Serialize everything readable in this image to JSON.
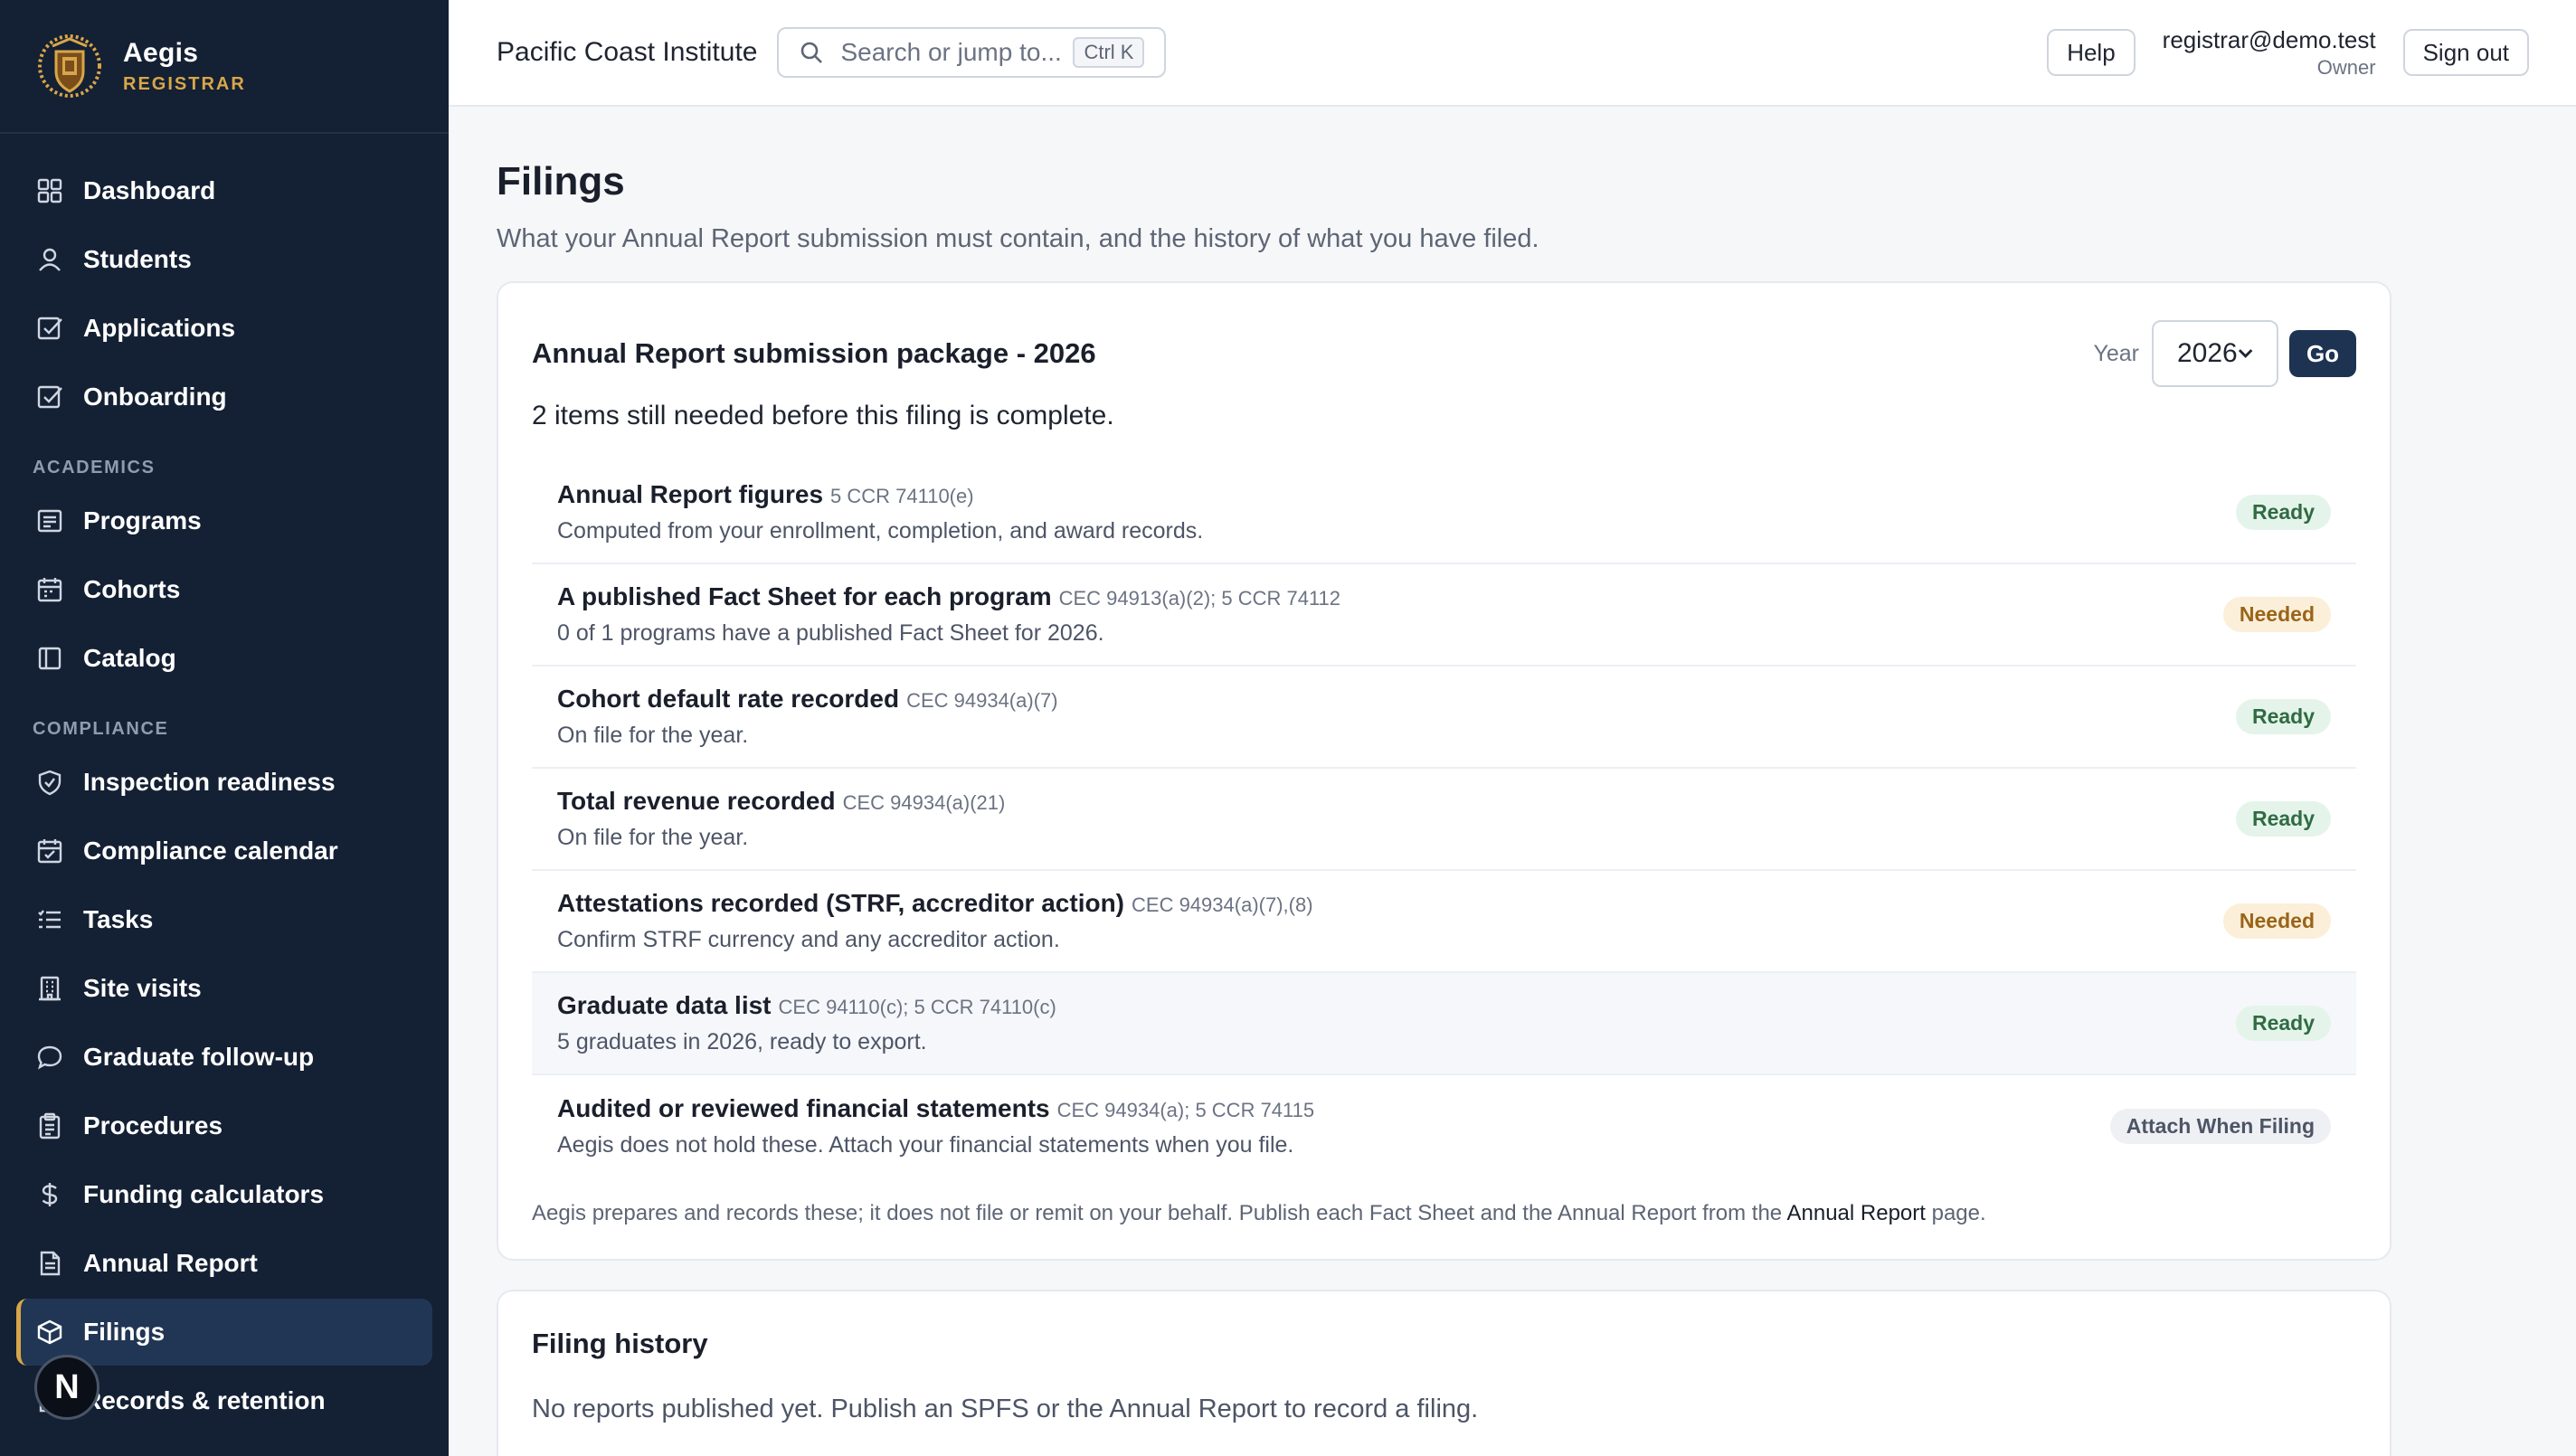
{
  "brand": {
    "name": "Aegis",
    "sub": "REGISTRAR"
  },
  "sidebar": {
    "items_top": [
      {
        "label": "Dashboard",
        "icon": "grid-icon"
      },
      {
        "label": "Students",
        "icon": "user-icon"
      },
      {
        "label": "Applications",
        "icon": "checkbox-icon"
      },
      {
        "label": "Onboarding",
        "icon": "checkbox-icon"
      }
    ],
    "section_academics": "ACADEMICS",
    "items_academics": [
      {
        "label": "Programs",
        "icon": "list-box-icon"
      },
      {
        "label": "Cohorts",
        "icon": "calendar-icon"
      },
      {
        "label": "Catalog",
        "icon": "book-icon"
      }
    ],
    "section_compliance": "COMPLIANCE",
    "items_compliance": [
      {
        "label": "Inspection readiness",
        "icon": "shield-icon"
      },
      {
        "label": "Compliance calendar",
        "icon": "calendar-check-icon"
      },
      {
        "label": "Tasks",
        "icon": "tasks-icon"
      },
      {
        "label": "Site visits",
        "icon": "building-icon"
      },
      {
        "label": "Graduate follow-up",
        "icon": "chat-icon"
      },
      {
        "label": "Procedures",
        "icon": "clipboard-icon"
      },
      {
        "label": "Funding calculators",
        "icon": "dollar-icon"
      },
      {
        "label": "Annual Report",
        "icon": "document-icon"
      },
      {
        "label": "Filings",
        "icon": "package-icon",
        "active": true
      },
      {
        "label": "Records & retention",
        "icon": "archive-icon"
      }
    ],
    "bottom_badge": "N"
  },
  "topbar": {
    "org": "Pacific Coast Institute",
    "search_placeholder": "Search or jump to...",
    "search_shortcut": "Ctrl K",
    "help": "Help",
    "user_email": "registrar@demo.test",
    "user_role": "Owner",
    "sign_out": "Sign out"
  },
  "page": {
    "title": "Filings",
    "subtitle": "What your Annual Report submission must contain, and the history of what you have filed."
  },
  "package": {
    "title": "Annual Report submission package - 2026",
    "year_label": "Year",
    "year_value": "2026",
    "go": "Go",
    "note": "2 items still needed before this filing is complete.",
    "items": [
      {
        "title": "Annual Report figures",
        "cite": "5 CCR 74110(e)",
        "desc": "Computed from your enrollment, completion, and award records.",
        "status": "Ready",
        "kind": "ready"
      },
      {
        "title": "A published Fact Sheet for each program",
        "cite": "CEC 94913(a)(2); 5 CCR 74112",
        "desc": "0 of 1 programs have a published Fact Sheet for 2026.",
        "status": "Needed",
        "kind": "needed"
      },
      {
        "title": "Cohort default rate recorded",
        "cite": "CEC 94934(a)(7)",
        "desc": "On file for the year.",
        "status": "Ready",
        "kind": "ready"
      },
      {
        "title": "Total revenue recorded",
        "cite": "CEC 94934(a)(21)",
        "desc": "On file for the year.",
        "status": "Ready",
        "kind": "ready"
      },
      {
        "title": "Attestations recorded (STRF, accreditor action)",
        "cite": "CEC 94934(a)(7),(8)",
        "desc": "Confirm STRF currency and any accreditor action.",
        "status": "Needed",
        "kind": "needed"
      },
      {
        "title": "Graduate data list",
        "cite": "CEC 94110(c); 5 CCR 74110(c)",
        "desc": "5 graduates in 2026, ready to export.",
        "status": "Ready",
        "kind": "ready",
        "highlight": true
      },
      {
        "title": "Audited or reviewed financial statements",
        "cite": "CEC 94934(a); 5 CCR 74115",
        "desc": "Aegis does not hold these. Attach your financial statements when you file.",
        "status": "Attach When Filing",
        "kind": "attach"
      }
    ],
    "footer_pre": "Aegis prepares and records these; it does not file or remit on your behalf. Publish each Fact Sheet and the Annual Report from the ",
    "footer_link": "Annual Report",
    "footer_post": " page."
  },
  "history": {
    "title": "Filing history",
    "empty": "No reports published yet. Publish an SPFS or the Annual Report to record a filing."
  },
  "colors": {
    "sidebar_bg": "#142033",
    "accent_gold": "#d8a64a",
    "primary_button": "#1e3352"
  }
}
